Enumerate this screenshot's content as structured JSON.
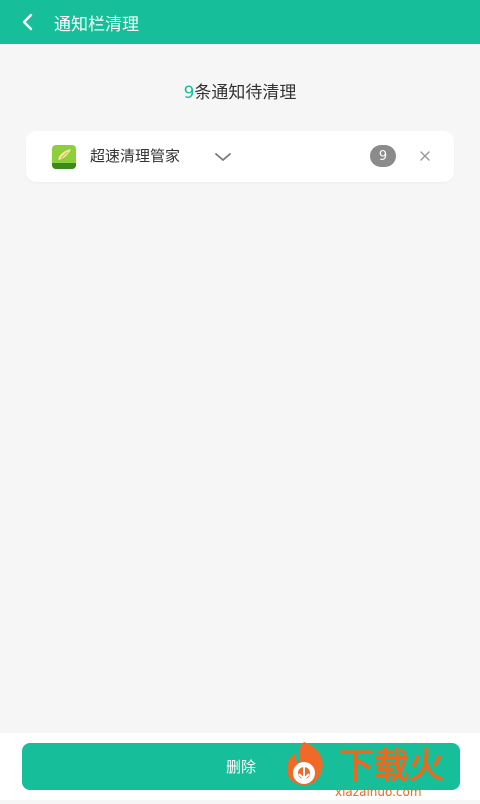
{
  "header": {
    "title": "通知栏清理",
    "back_icon": "chevron-left-icon"
  },
  "summary": {
    "count": "9",
    "text": "条通知待清理"
  },
  "notification_group": {
    "app_name": "超速清理管家",
    "expand_icon": "chevron-down-icon",
    "badge_count": "9",
    "dismiss_icon": "close-icon"
  },
  "footer": {
    "delete_label": "删除"
  },
  "watermark": {
    "brand_text": "下载火",
    "url": "xiazaihuo.com",
    "flame_icon": "flame-logo-icon"
  },
  "colors": {
    "primary": "#16bf9a",
    "background": "#f6f6f6",
    "card": "#ffffff",
    "badge": "#8b8b8b",
    "watermark": "#e66a1f"
  }
}
